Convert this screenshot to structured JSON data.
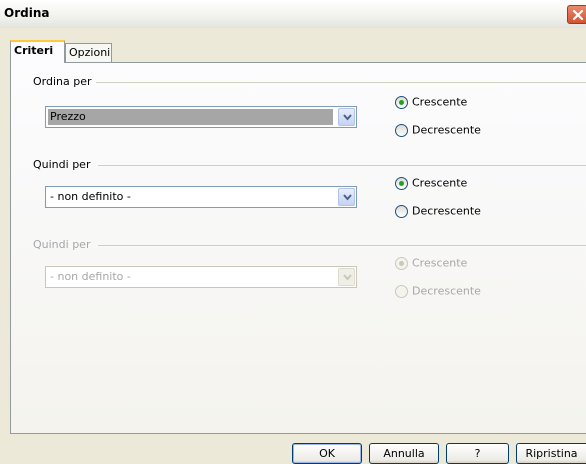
{
  "window": {
    "title": "Ordina"
  },
  "tabs": [
    {
      "label": "Criteri",
      "active": true
    },
    {
      "label": "Opzioni",
      "active": false
    }
  ],
  "sections": [
    {
      "label": "Ordina per",
      "value": "Prezzo",
      "enabled": true,
      "ascending": {
        "label": "Crescente",
        "checked": true
      },
      "descending": {
        "label": "Decrescente",
        "checked": false
      }
    },
    {
      "label": "Quindi per",
      "value": "- non definito -",
      "enabled": true,
      "ascending": {
        "label": "Crescente",
        "checked": true
      },
      "descending": {
        "label": "Decrescente",
        "checked": false
      }
    },
    {
      "label": "Quindi per",
      "value": "- non definito -",
      "enabled": false,
      "ascending": {
        "label": "Crescente",
        "checked": true
      },
      "descending": {
        "label": "Decrescente",
        "checked": false
      }
    }
  ],
  "buttons": {
    "ok": "OK",
    "cancel": "Annulla",
    "help": "?",
    "reset": "Ripristina"
  },
  "colors": {
    "titlebar_close": "#d4532f",
    "tab_accent": "#ffc83c",
    "radio_dot": "#22a31c"
  }
}
